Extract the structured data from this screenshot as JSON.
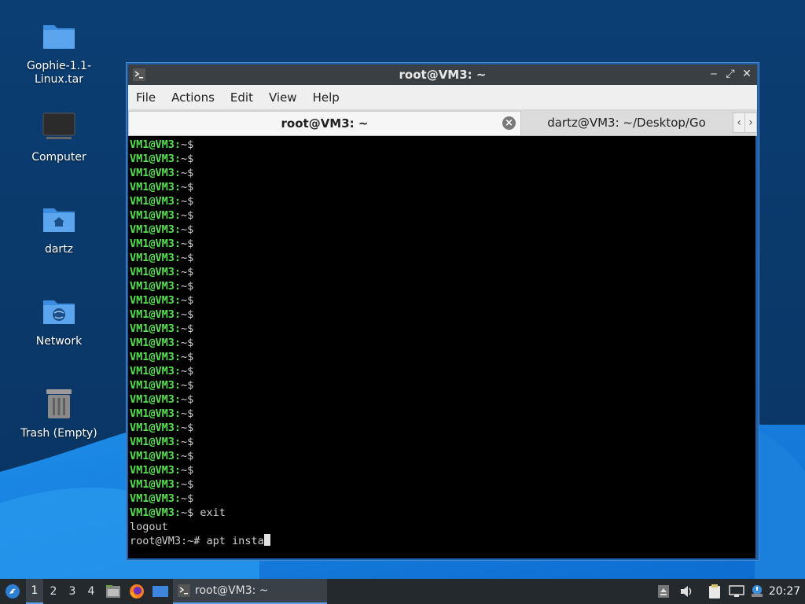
{
  "desktop": {
    "icons": [
      {
        "label": "Gophie-1.1-\nLinux.tar",
        "icon": "folder-icon"
      },
      {
        "label": "Computer",
        "icon": "monitor-icon"
      },
      {
        "label": "dartz",
        "icon": "home-folder-icon"
      },
      {
        "label": "Network",
        "icon": "network-folder-icon"
      },
      {
        "label": "Trash (Empty)",
        "icon": "trash-icon"
      }
    ]
  },
  "window": {
    "title": "root@VM3: ~",
    "buttons": {
      "minimize": "‒",
      "maximize": "⤢",
      "close": "✕"
    }
  },
  "menu": [
    "File",
    "Actions",
    "Edit",
    "View",
    "Help"
  ],
  "tabs": [
    {
      "label": "root@VM3: ~",
      "active": true
    },
    {
      "label": "dartz@VM3: ~/Desktop/Go",
      "active": false
    }
  ],
  "tab_scroll": {
    "left": "‹",
    "right": "›"
  },
  "terminal": {
    "prompt": "VM1@VM3:",
    "prompt_suffix": "~$",
    "repeated_prompt_lines": 26,
    "exit_line_cmd": " exit",
    "logout_line": "logout",
    "root_prompt": "root@VM3:~# ",
    "current_input": "apt insta"
  },
  "taskbar": {
    "workspaces": [
      "1",
      "2",
      "3",
      "4"
    ],
    "active_workspace": "1",
    "task_label": "root@VM3: ~",
    "clock": "20:27"
  },
  "colors": {
    "prompt_green": "#55e050",
    "desktop_blue": "#0a3a6b",
    "window_border": "#1f5fa8"
  }
}
